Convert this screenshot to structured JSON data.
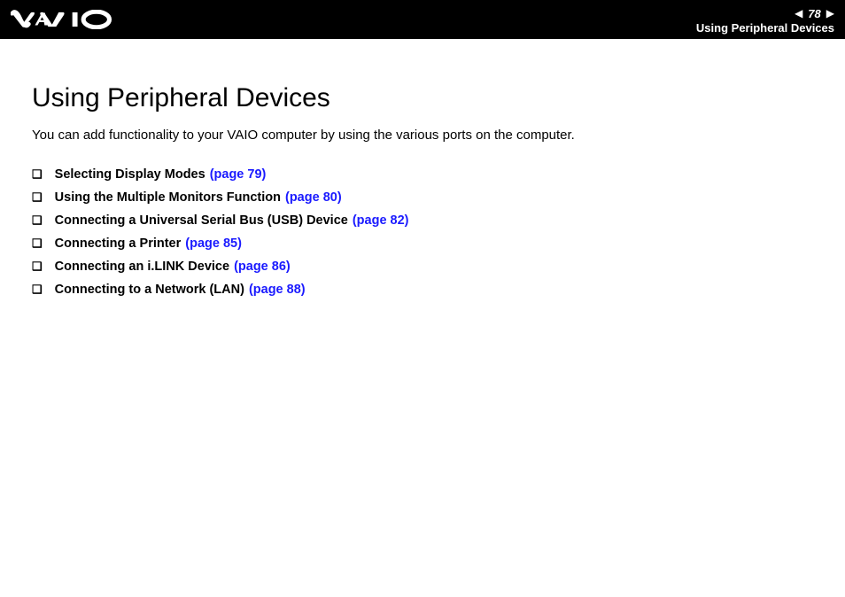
{
  "header": {
    "page_number": "78",
    "section_label": "Using Peripheral Devices"
  },
  "content": {
    "title": "Using Peripheral Devices",
    "intro": "You can add functionality to your VAIO computer by using the various ports on the computer.",
    "toc": [
      {
        "label": "Selecting Display Modes",
        "page_ref": "(page 79)"
      },
      {
        "label": "Using the Multiple Monitors Function",
        "page_ref": "(page 80)"
      },
      {
        "label": "Connecting a Universal Serial Bus (USB) Device",
        "page_ref": "(page 82)"
      },
      {
        "label": "Connecting a Printer",
        "page_ref": "(page 85)"
      },
      {
        "label": "Connecting an i.LINK Device",
        "page_ref": "(page 86)"
      },
      {
        "label": "Connecting to a Network (LAN)",
        "page_ref": "(page 88)"
      }
    ]
  }
}
